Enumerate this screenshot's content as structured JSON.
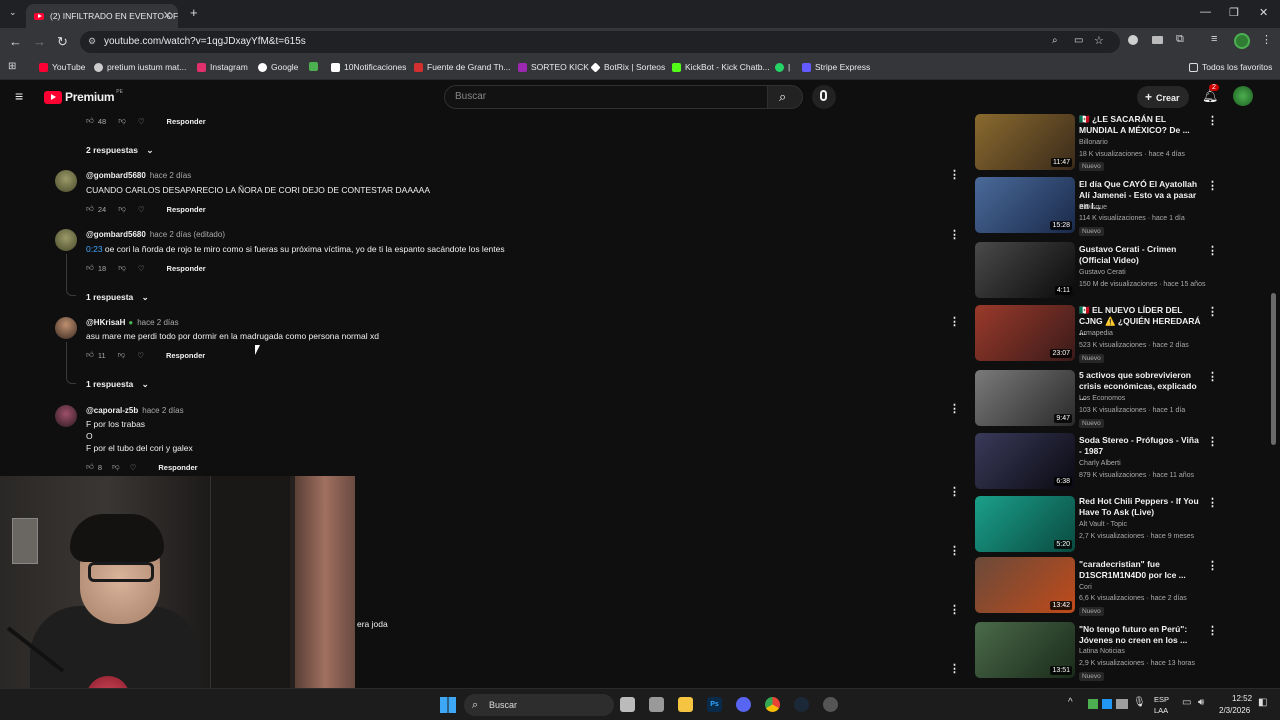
{
  "browser": {
    "tab_title": "(2) INFILTRADO EN EVENTO OF",
    "url": "youtube.com/watch?v=1qgJDxayYfM&t=615s",
    "bookmarks": [
      {
        "label": "YouTube",
        "color": "#ff0033"
      },
      {
        "label": "pretium iustum mat...",
        "color": "#cccccc"
      },
      {
        "label": "Instagram",
        "color": "#e1306c"
      },
      {
        "label": "Google",
        "color": "#ffffff"
      },
      {
        "label": "",
        "color": "#4caf50"
      },
      {
        "label": "10Notificaciones",
        "color": "#ffffff"
      },
      {
        "label": "Fuente de Grand Th...",
        "color": "#d32f2f"
      },
      {
        "label": "SORTEO KICK",
        "color": "#9c27b0"
      },
      {
        "label": "BotRix | Sorteos",
        "color": "#ffffff"
      },
      {
        "label": "KickBot - Kick Chatb...",
        "color": "#53fc18"
      },
      {
        "label": "|",
        "color": "#25d366"
      },
      {
        "label": "Stripe Express",
        "color": "#635bff"
      }
    ],
    "all_favorites": "Todos los favoritos"
  },
  "youtube": {
    "logo_text": "Premium",
    "logo_region": "PE",
    "search_placeholder": "Buscar",
    "create_label": "Crear",
    "notif_count": "2"
  },
  "comments": {
    "top_likes": "48",
    "reply_label": "Responder",
    "items": [
      {
        "replies": "2 respuestas"
      },
      {
        "user": "@gombard5680",
        "time": "hace 2 días",
        "text": "CUANDO CARLOS DESAPARECIO LA ÑORA DE CORI DEJO DE CONTESTAR DAAAAA",
        "likes": "24"
      },
      {
        "user": "@gombard5680",
        "time": "hace 2 días (editado)",
        "timestamp": "0:23",
        "text": " oe cori la ñorda de rojo te miro como si fueras su próxima víctima, yo de ti la espanto sacándote los lentes",
        "likes": "18",
        "replies": "1 respuesta"
      },
      {
        "user": "@HKrisaH",
        "time": "hace 2 días",
        "text": "asu mare me perdi todo por dormir en la madrugada como persona normal xd",
        "likes": "11",
        "replies": "1 respuesta"
      },
      {
        "user": "@caporal-z5b",
        "time": "hace 2 días",
        "text_lines": [
          "F por los trabas",
          "O",
          "F por el tubo del cori y galex"
        ],
        "likes": "8"
      }
    ],
    "partial_text": "era joda"
  },
  "sidebar": {
    "videos": [
      {
        "title": "🇲🇽 ¿LE SACARÁN EL MUNDIAL A MÉXICO? De ...",
        "channel": "Billonario",
        "meta": "18 K visualizaciones · hace 4 días",
        "duration": "11:47",
        "badge": "Nuevo",
        "thumb": "#6b4a1e"
      },
      {
        "title": "El día Que CAYÓ El Ayatollah Alí Jamenei - Esto va a pasar en I...",
        "channel": "ElDisque",
        "meta": "114 K visualizaciones · hace 1 día",
        "duration": "15:28",
        "badge": "Nuevo",
        "thumb": "#3a5a8a"
      },
      {
        "title": "Gustavo Cerati - Crimen (Official Video)",
        "channel": "Gustavo Cerati",
        "meta": "150 M de visualizaciones · hace 15 años",
        "duration": "4:11",
        "badge": "",
        "thumb": "#2a2a2a"
      },
      {
        "title": "🇲🇽 EL NUEVO LÍDER DEL CJNG ⚠️ ¿QUIÉN HEREDARÁ ...",
        "channel": "Armapedia",
        "meta": "523 K visualizaciones · hace 2 días",
        "duration": "23:07",
        "badge": "Nuevo",
        "thumb": "#7a2a1a"
      },
      {
        "title": "5 activos que sobrevivieron crisis económicas, explicado ...",
        "channel": "Los Economos",
        "meta": "103 K visualizaciones · hace 1 día",
        "duration": "9:47",
        "badge": "Nuevo",
        "thumb": "#5a5a5a"
      },
      {
        "title": "Soda Stereo - Prófugos - Viña - 1987",
        "channel": "Charly Alberti",
        "meta": "879 K visualizaciones · hace 11 años",
        "duration": "6:38",
        "badge": "",
        "thumb": "#1a1a22"
      },
      {
        "title": "Red Hot Chili Peppers - If You Have To Ask (Live)",
        "channel": "Alt Vault - Topic",
        "meta": "2,7 K visualizaciones · hace 9 meses",
        "duration": "5:20",
        "badge": "",
        "thumb": "#1a8a7a"
      },
      {
        "title": "\"caradecristian\" fue D1SCR1M1N4D0 por Ice ...",
        "channel": "Cori",
        "meta": "6,6 K visualizaciones · hace 2 días",
        "duration": "13:42",
        "badge": "Nuevo",
        "thumb": "#4a3a2a"
      },
      {
        "title": "\"No tengo futuro en Perú\": Jóvenes no creen en los ...",
        "channel": "Latina Noticias",
        "meta": "2,9 K visualizaciones · hace 13 horas",
        "duration": "13:51",
        "badge": "Nuevo",
        "thumb": "#3a4a3a"
      }
    ]
  },
  "taskbar": {
    "search_label": "Buscar",
    "lang": "ESP",
    "lang2": "LAA",
    "time": "12:52",
    "date": "2/3/2026"
  }
}
